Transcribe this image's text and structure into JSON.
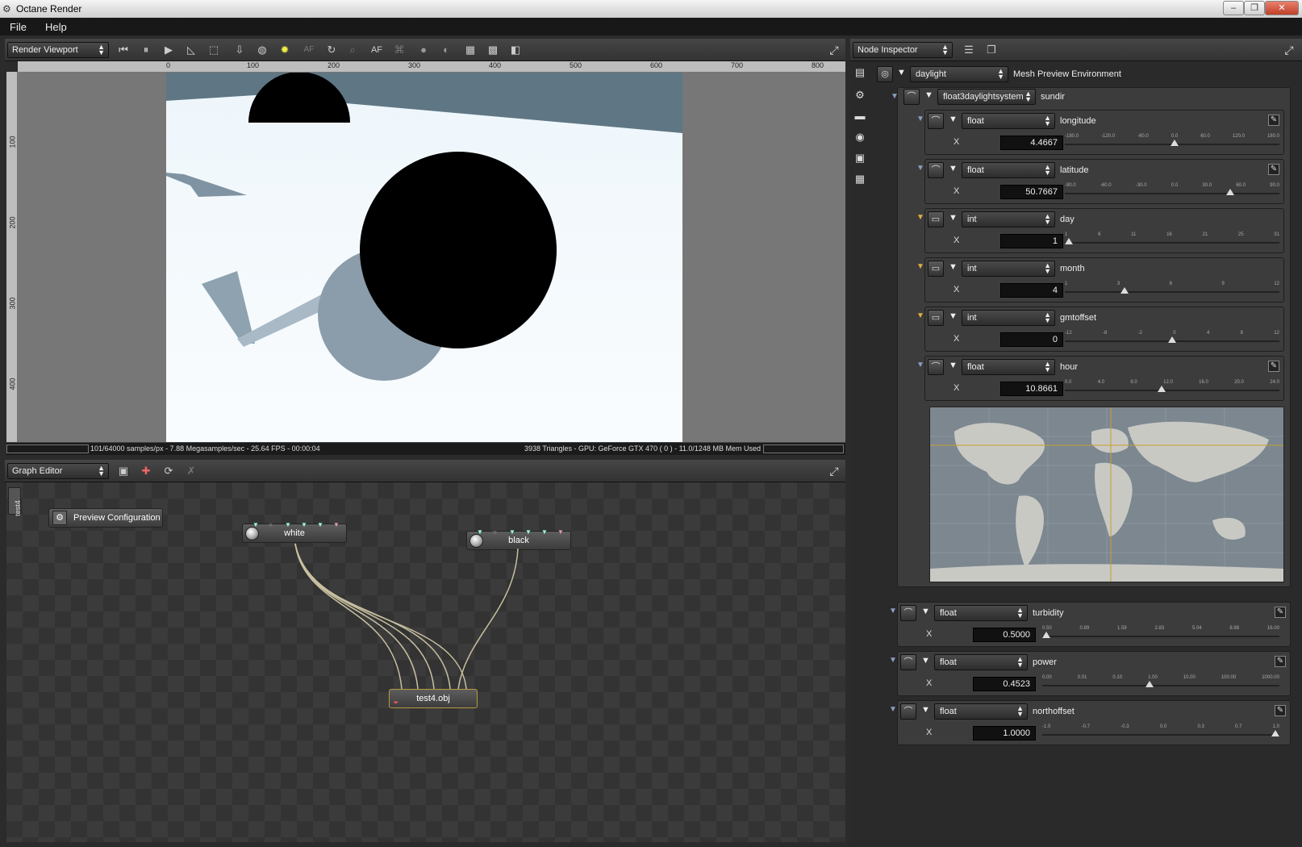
{
  "window": {
    "title": "Octane Render",
    "controls": [
      "–",
      "❐",
      "✕"
    ]
  },
  "menu": [
    "File",
    "Help"
  ],
  "viewport": {
    "header": "Render Viewport",
    "ruler_x": [
      "0",
      "100",
      "200",
      "300",
      "400",
      "500",
      "600",
      "700",
      "800"
    ],
    "ruler_y": [
      "100",
      "200",
      "300",
      "400"
    ],
    "status_left": "101/64000 samples/px - 7.88 Megasamples/sec - 25.64 FPS - 00:00:04",
    "status_right": "3938 Triangles - GPU: GeForce GTX 470 ( 0 ) - 11.0/1248 MB Mem Used",
    "af_label": "AF"
  },
  "graph": {
    "header": "Graph Editor",
    "side_tab": "test4",
    "preview_config": "Preview Configuration",
    "nodes": {
      "white": "white",
      "black": "black",
      "obj": "test4.obj"
    }
  },
  "inspector": {
    "header": "Node Inspector",
    "root_type": "daylight",
    "root_label": "Mesh Preview Environment",
    "system_type": "float3daylightsystem",
    "system_label": "sundir",
    "params": [
      {
        "type": "float",
        "name": "longitude",
        "value": "4.4667",
        "ticks": [
          "-180.0",
          "-120.0",
          "-60.0",
          "0.0",
          "60.0",
          "120.0",
          "180.0"
        ],
        "thumb": 0.51,
        "color": "#8aa0c0"
      },
      {
        "type": "float",
        "name": "latitude",
        "value": "50.7667",
        "ticks": [
          "-90.0",
          "-60.0",
          "-30.0",
          "0.0",
          "30.0",
          "60.0",
          "90.0"
        ],
        "thumb": 0.78,
        "color": "#8aa0c0"
      },
      {
        "type": "int",
        "name": "day",
        "value": "1",
        "ticks": [
          "1",
          "6",
          "11",
          "16",
          "21",
          "25",
          "31"
        ],
        "thumb": 0.0,
        "color": "#e0b040"
      },
      {
        "type": "int",
        "name": "month",
        "value": "4",
        "ticks": [
          "1",
          "3",
          "6",
          "9",
          "12"
        ],
        "thumb": 0.27,
        "color": "#e0b040"
      },
      {
        "type": "int",
        "name": "gmtoffset",
        "value": "0",
        "ticks": [
          "-12",
          "-8",
          "-2",
          "0",
          "4",
          "8",
          "12"
        ],
        "thumb": 0.5,
        "color": "#e0b040"
      },
      {
        "type": "float",
        "name": "hour",
        "value": "10.8661",
        "ticks": [
          "0.0",
          "4.0",
          "8.0",
          "12.0",
          "16.0",
          "20.0",
          "24.0"
        ],
        "thumb": 0.45,
        "color": "#8aa0c0"
      }
    ],
    "bottom_params": [
      {
        "type": "float",
        "name": "turbidity",
        "value": "0.5000",
        "ticks": [
          "0.50",
          "0.89",
          "1.59",
          "2.83",
          "5.04",
          "8.98",
          "16.00"
        ],
        "thumb": 0.0
      },
      {
        "type": "float",
        "name": "power",
        "value": "0.4523",
        "ticks": [
          "0.00",
          "0.01",
          "0.10",
          "1.00",
          "10.00",
          "100.00",
          "1000.00"
        ],
        "thumb": 0.45
      },
      {
        "type": "float",
        "name": "northoffset",
        "value": "1.0000",
        "ticks": [
          "-1.0",
          "-0.7",
          "-0.3",
          "0.0",
          "0.3",
          "0.7",
          "1.0"
        ],
        "thumb": 1.0
      }
    ],
    "x_label": "X"
  },
  "icons": {
    "dropdown": "updown-arrows-icon",
    "maximize": "maximize-icon",
    "collapse": "triangle-down-icon",
    "edit": "pencil-icon"
  }
}
